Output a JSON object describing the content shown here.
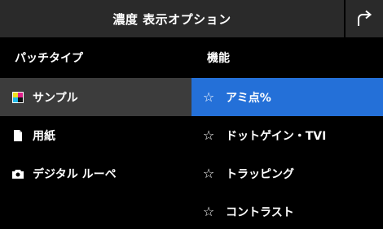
{
  "header": {
    "title": "濃度 表示オプション",
    "back_icon": "return-arrow-icon"
  },
  "left_panel": {
    "heading": "パッチタイプ",
    "items": [
      {
        "label": "サンプル",
        "icon": "color-patch-icon",
        "selected": true
      },
      {
        "label": "用紙",
        "icon": "document-icon",
        "selected": false
      },
      {
        "label": "デジタル ルーペ",
        "icon": "camera-icon",
        "selected": false
      }
    ]
  },
  "right_panel": {
    "heading": "機能",
    "items": [
      {
        "label": "アミ点%",
        "icon": "star-icon",
        "selected": true
      },
      {
        "label": "ドットゲイン・TVI",
        "icon": "star-icon",
        "selected": false
      },
      {
        "label": "トラッピング",
        "icon": "star-icon",
        "selected": false
      },
      {
        "label": "コントラスト",
        "icon": "star-icon",
        "selected": false
      }
    ]
  },
  "colors": {
    "background": "#000000",
    "titlebar": "#2a2a2a",
    "left_selected": "#3c3c3c",
    "accent": "#2470d8"
  }
}
